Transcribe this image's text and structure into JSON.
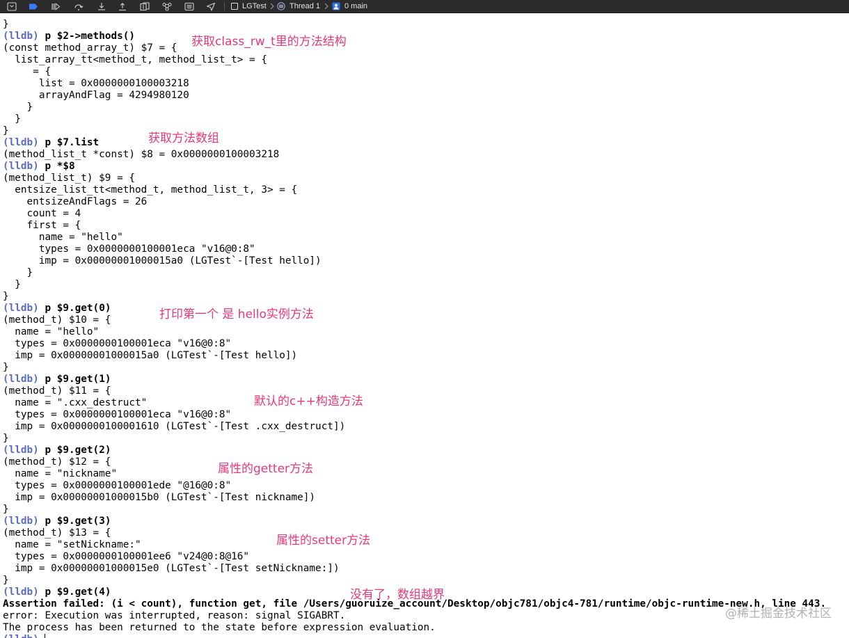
{
  "colors": {
    "toolbar_background": "#2b2b2d",
    "toolbar_icon": "#cfcfcf",
    "toolbar_text": "#e4e4e4",
    "breakpoint_blue": "#3a7bf7",
    "prompt": "#5a6bc8",
    "annotation": "#e8377a",
    "console_background": "#ffffff",
    "console_text": "#000000",
    "watermark": "#a9a9a9"
  },
  "toolbar": {
    "icons": [
      "hide-debug-area-icon",
      "breakpoints-toggle-icon",
      "continue-icon",
      "step-over-icon",
      "step-into-icon",
      "step-out-icon",
      "debug-view-hierarchy-icon",
      "memory-graph-icon",
      "environment-overrides-icon",
      "simulate-location-icon"
    ],
    "jump_bar": {
      "target_icon": "app-target-icon",
      "target": "LGTest",
      "thread_icon": "thread-icon",
      "thread": "Thread 1",
      "frame_icon": "stack-frame-icon",
      "frame": "0 main"
    }
  },
  "console": {
    "lines": [
      {
        "text": "}"
      },
      {
        "prompt": "(lldb)",
        "command": "p $2->methods()"
      },
      {
        "text": "(const method_array_t) $7 = {"
      },
      {
        "text": "  list_array_tt<method_t, method_list_t> = {"
      },
      {
        "text": "     = {"
      },
      {
        "text": "      list = 0x0000000100003218"
      },
      {
        "text": "      arrayAndFlag = 4294980120"
      },
      {
        "text": "    }"
      },
      {
        "text": "  }"
      },
      {
        "text": "}"
      },
      {
        "prompt": "(lldb)",
        "command": "p $7.list"
      },
      {
        "text": "(method_list_t *const) $8 = 0x0000000100003218"
      },
      {
        "prompt": "(lldb)",
        "command": "p *$8"
      },
      {
        "text": "(method_list_t) $9 = {"
      },
      {
        "text": "  entsize_list_tt<method_t, method_list_t, 3> = {"
      },
      {
        "text": "    entsizeAndFlags = 26"
      },
      {
        "text": "    count = 4"
      },
      {
        "text": "    first = {"
      },
      {
        "text": "      name = \"hello\""
      },
      {
        "text": "      types = 0x0000000100001eca \"v16@0:8\""
      },
      {
        "text": "      imp = 0x00000001000015a0 (LGTest`-[Test hello])"
      },
      {
        "text": "    }"
      },
      {
        "text": "  }"
      },
      {
        "text": "}"
      },
      {
        "prompt": "(lldb)",
        "command": "p $9.get(0)"
      },
      {
        "text": "(method_t) $10 = {"
      },
      {
        "text": "  name = \"hello\""
      },
      {
        "text": "  types = 0x0000000100001eca \"v16@0:8\""
      },
      {
        "text": "  imp = 0x00000001000015a0 (LGTest`-[Test hello])"
      },
      {
        "text": "}"
      },
      {
        "prompt": "(lldb)",
        "command": "p $9.get(1)"
      },
      {
        "text": "(method_t) $11 = {"
      },
      {
        "text": "  name = \".cxx_destruct\""
      },
      {
        "text": "  types = 0x0000000100001eca \"v16@0:8\""
      },
      {
        "text": "  imp = 0x0000000100001610 (LGTest`-[Test .cxx_destruct])"
      },
      {
        "text": "}"
      },
      {
        "prompt": "(lldb)",
        "command": "p $9.get(2)"
      },
      {
        "text": "(method_t) $12 = {"
      },
      {
        "text": "  name = \"nickname\""
      },
      {
        "text": "  types = 0x0000000100001ede \"@16@0:8\""
      },
      {
        "text": "  imp = 0x00000001000015b0 (LGTest`-[Test nickname])"
      },
      {
        "text": "}"
      },
      {
        "prompt": "(lldb)",
        "command": "p $9.get(3)"
      },
      {
        "text": "(method_t) $13 = {"
      },
      {
        "text": "  name = \"setNickname:\""
      },
      {
        "text": "  types = 0x0000000100001ee6 \"v24@0:8@16\""
      },
      {
        "text": "  imp = 0x00000001000015e0 (LGTest`-[Test setNickname:])"
      },
      {
        "text": "}"
      },
      {
        "prompt": "(lldb)",
        "command": "p $9.get(4)"
      },
      {
        "text": "Assertion failed: (i < count), function get, file /Users/guoruize_account/Desktop/objc781/objc4-781/runtime/objc-runtime-new.h, line 443.",
        "bold": true
      },
      {
        "text": "error: Execution was interrupted, reason: signal SIGABRT."
      },
      {
        "text": "The process has been returned to the state before expression evaluation."
      },
      {
        "prompt": "(lldb)",
        "input": ""
      }
    ]
  },
  "annotations": [
    {
      "text": "获取class_rw_t里的方法结构"
    },
    {
      "text": "获取方法数组"
    },
    {
      "text": "打印第一个 是 hello实例方法"
    },
    {
      "text": "默认的c++构造方法"
    },
    {
      "text": "属性的getter方法"
    },
    {
      "text": "属性的setter方法"
    },
    {
      "text": "没有了，数组越界"
    }
  ],
  "watermark": "@稀土掘金技术社区"
}
